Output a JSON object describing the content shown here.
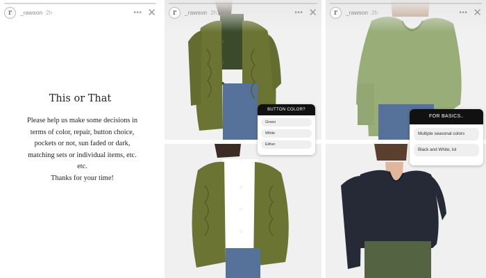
{
  "stories": [
    {
      "header": {
        "avatar_glyph": "r",
        "username": "_rawson",
        "time": "2h",
        "more_icon": "more-dots-icon",
        "close_icon": "close-icon"
      },
      "title": "This or That",
      "body": "Please help us make some decisions in terms of color, repair, button choice, pockets or not, sun faded or dark, matching sets or individual items, etc. etc.",
      "thanks": "Thanks for your time!"
    },
    {
      "header": {
        "avatar_glyph": "r",
        "username": "_rawson",
        "time": "2h",
        "more_icon": "more-dots-icon",
        "close_icon": "close-icon"
      },
      "poll": {
        "question": "BUTTON COLOR?",
        "options": [
          "Green",
          "White",
          "Either"
        ]
      }
    },
    {
      "header": {
        "avatar_glyph": "r",
        "username": "_rawson",
        "time": "2h",
        "more_icon": "more-dots-icon",
        "close_icon": "close-icon"
      },
      "poll": {
        "question": "FOR BASICS..",
        "options": [
          "Multiple seasonal colors",
          "Black and White, lol"
        ]
      }
    }
  ],
  "colors": {
    "olive_jacket": "#6b7433",
    "sage_top": "#98ad78",
    "navy_top": "#262a36",
    "denim": "#56729a",
    "poll_header": "#111111"
  }
}
